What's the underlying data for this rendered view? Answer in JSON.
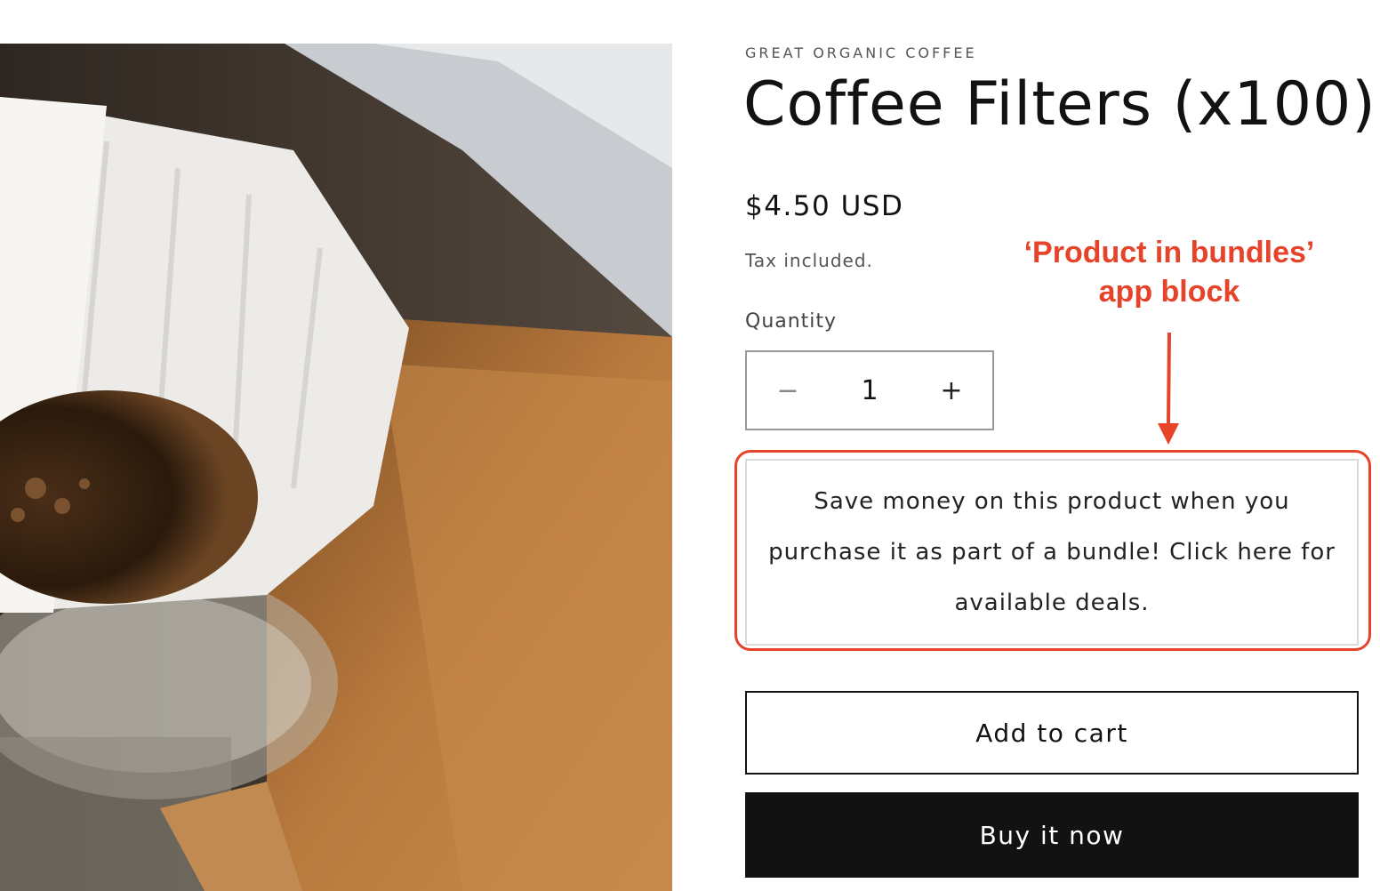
{
  "product": {
    "vendor": "GREAT ORGANIC COFFEE",
    "title": "Coffee Filters (x100)",
    "price": "$4.50 USD",
    "tax_note": "Tax included.",
    "image_alt": "Pour-over coffee dripper with paper filter and coffee grounds"
  },
  "quantity": {
    "label": "Quantity",
    "value": "1",
    "decrease_symbol": "−",
    "increase_symbol": "+"
  },
  "bundle_block": {
    "text": "Save money on this product when you purchase it as part of a bundle! Click here for available deals."
  },
  "annotation": {
    "line1": "‘Product in bundles’",
    "line2": "app block",
    "color": "#e5432a"
  },
  "buttons": {
    "add_to_cart": "Add to cart",
    "buy_now": "Buy it now"
  }
}
